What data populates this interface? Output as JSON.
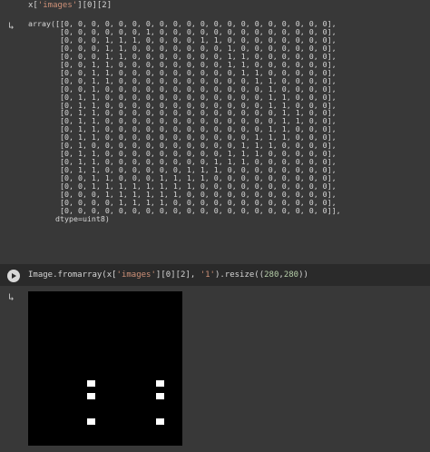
{
  "cell1": {
    "code_prefix": "x[",
    "code_str": "'images'",
    "code_suffix": "][0][2]"
  },
  "output1": {
    "icon": "output-redirect-icon",
    "array_lines": [
      "array([[0, 0, 0, 0, 0, 0, 0, 0, 0, 0, 0, 0, 0, 0, 0, 0, 0, 0, 0, 0],",
      "       [0, 0, 0, 0, 0, 0, 1, 0, 0, 0, 0, 0, 0, 0, 0, 0, 0, 0, 0, 0],",
      "       [0, 0, 0, 1, 1, 1, 0, 0, 0, 0, 1, 1, 0, 0, 0, 0, 0, 0, 0, 0],",
      "       [0, 0, 0, 1, 1, 0, 0, 0, 0, 0, 0, 0, 1, 0, 0, 0, 0, 0, 0, 0],",
      "       [0, 0, 0, 1, 1, 0, 0, 0, 0, 0, 0, 0, 1, 1, 0, 0, 0, 0, 0, 0],",
      "       [0, 0, 1, 1, 0, 0, 0, 0, 0, 0, 0, 0, 1, 1, 0, 0, 0, 0, 0, 0],",
      "       [0, 0, 1, 1, 0, 0, 0, 0, 0, 0, 0, 0, 0, 1, 1, 0, 0, 0, 0, 0],",
      "       [0, 0, 1, 1, 0, 0, 0, 0, 0, 0, 0, 0, 0, 0, 1, 1, 0, 0, 0, 0],",
      "       [0, 0, 1, 0, 0, 0, 0, 0, 0, 0, 0, 0, 0, 0, 0, 1, 0, 0, 0, 0],",
      "       [0, 1, 1, 0, 0, 0, 0, 0, 0, 0, 0, 0, 0, 0, 0, 1, 1, 0, 0, 0],",
      "       [0, 1, 1, 0, 0, 0, 0, 0, 0, 0, 0, 0, 0, 0, 0, 1, 1, 0, 0, 0],",
      "       [0, 1, 1, 0, 0, 0, 0, 0, 0, 0, 0, 0, 0, 0, 0, 0, 1, 1, 0, 0],",
      "       [0, 1, 1, 0, 0, 0, 0, 0, 0, 0, 0, 0, 0, 0, 0, 0, 1, 1, 0, 0],",
      "       [0, 1, 1, 0, 0, 0, 0, 0, 0, 0, 0, 0, 0, 0, 0, 1, 1, 0, 0, 0],",
      "       [0, 1, 1, 0, 0, 0, 0, 0, 0, 0, 0, 0, 0, 0, 1, 1, 1, 0, 0, 0],",
      "       [0, 1, 0, 0, 0, 0, 0, 0, 0, 0, 0, 0, 0, 1, 1, 1, 0, 0, 0, 0],",
      "       [0, 1, 1, 0, 0, 0, 0, 0, 0, 0, 0, 0, 1, 1, 1, 0, 0, 0, 0, 0],",
      "       [0, 1, 1, 0, 0, 0, 0, 0, 0, 0, 0, 1, 1, 1, 0, 0, 0, 0, 0, 0],",
      "       [0, 1, 1, 0, 0, 0, 0, 0, 0, 1, 1, 1, 0, 0, 0, 0, 0, 0, 0, 0],",
      "       [0, 0, 1, 1, 0, 0, 0, 1, 1, 1, 1, 0, 0, 0, 0, 0, 0, 0, 0, 0],",
      "       [0, 0, 1, 1, 1, 1, 1, 1, 1, 1, 0, 0, 0, 0, 0, 0, 0, 0, 0, 0],",
      "       [0, 0, 0, 1, 1, 1, 1, 1, 1, 0, 0, 0, 0, 0, 0, 0, 0, 0, 0, 0],",
      "       [0, 0, 0, 0, 1, 1, 1, 1, 0, 0, 0, 0, 0, 0, 0, 0, 0, 0, 0, 0],",
      "       [0, 0, 0, 0, 0, 0, 0, 0, 0, 0, 0, 0, 0, 0, 0, 0, 0, 0, 0, 0]],",
      "      dtype=uint8)"
    ]
  },
  "cell2": {
    "code_prefix": "Image.fromarray(x[",
    "code_str1": "'images'",
    "code_mid1": "][0][2], ",
    "code_str2": "'1'",
    "code_mid2": ").resize((",
    "code_num1": "280",
    "code_comma": ",",
    "code_num2": "280",
    "code_suffix": "))"
  },
  "output2": {
    "icon": "output-redirect-icon"
  }
}
